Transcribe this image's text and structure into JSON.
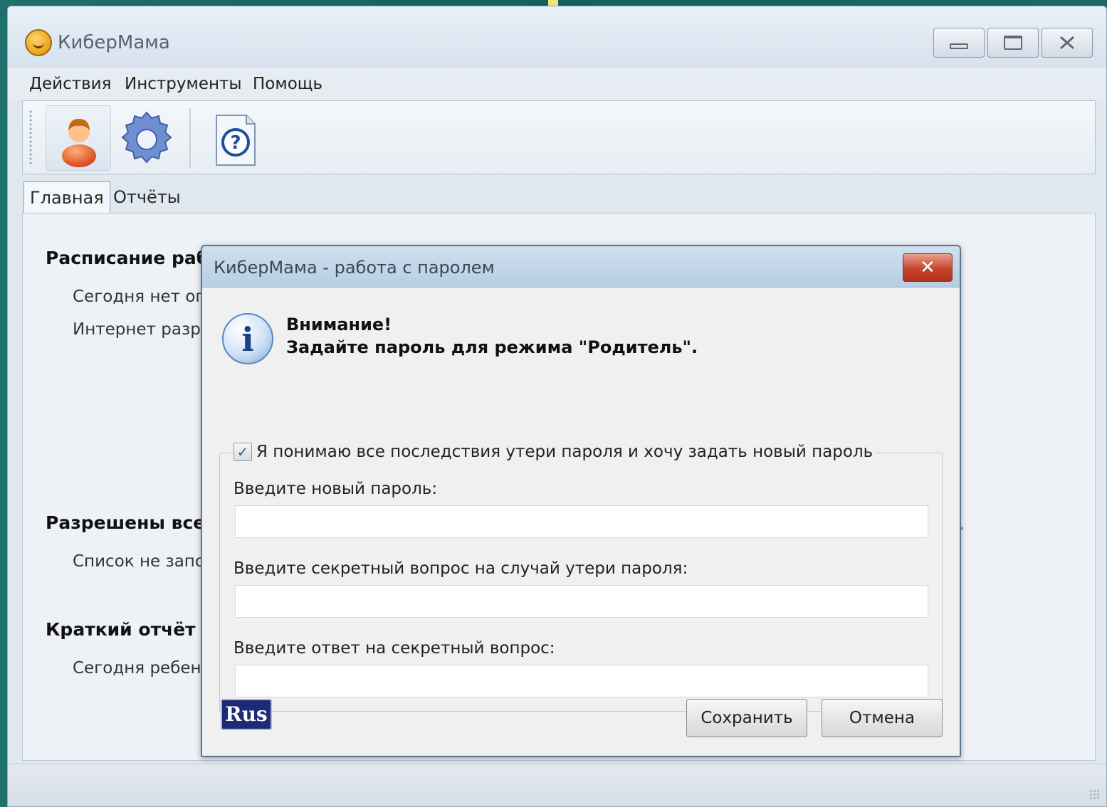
{
  "window": {
    "title": "КиберМама",
    "controls": {
      "minimize": "minimize",
      "maximize": "maximize",
      "close": "close"
    }
  },
  "menu": [
    "Действия",
    "Инструменты",
    "Помощь"
  ],
  "toolbar": {
    "buttons": [
      {
        "icon": "user-icon"
      },
      {
        "icon": "gear-icon"
      },
      {
        "icon": "help-document-icon"
      }
    ]
  },
  "tabs": [
    "Главная",
    "Отчёты"
  ],
  "main": {
    "schedule_title": "Расписание раб",
    "schedule_line1": "Сегодня нет огр",
    "schedule_line2": "Интернет разре",
    "allowed_title": "Разрешены все",
    "allowed_line": "Список не запо",
    "report_title": "Краткий отчёт о",
    "report_line": "Сегодня ребено"
  },
  "dialog": {
    "title": "КиберМама - работа с паролем",
    "close_glyph": "✕",
    "notice_line1": "Внимание!",
    "notice_line2": "Задайте пароль для режима \"Родитель\".",
    "checkbox_label": "Я понимаю все последствия утери пароля и хочу задать новый пароль",
    "checkbox_checked": true,
    "new_password_label": "Введите новый пароль:",
    "new_password_value": "",
    "secret_question_label": "Введите секретный вопрос на случай утери пароля:",
    "secret_question_value": "",
    "secret_answer_label": "Введите ответ на секретный вопрос:",
    "secret_answer_value": "",
    "language": "Rus",
    "save_label": "Сохранить",
    "cancel_label": "Отмена"
  },
  "colors": {
    "desktop": "#1a6a66",
    "lang_badge": "#1d2a78",
    "close_button": "#c8432c"
  }
}
